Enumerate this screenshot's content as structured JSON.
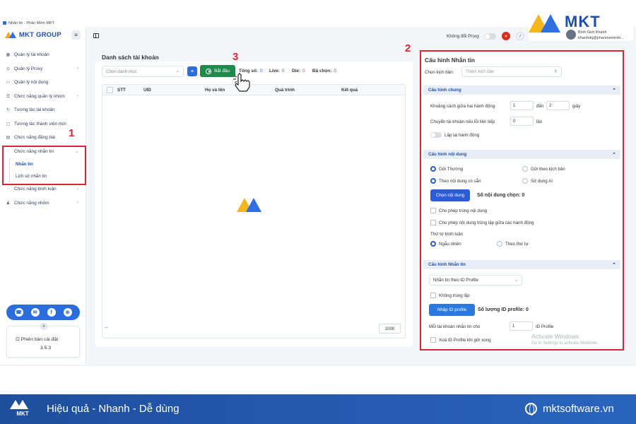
{
  "window": {
    "title": "Nhắn tin - Phần Mềm MKT"
  },
  "brand": {
    "name": "MKT GROUP",
    "top_logo": "MKT",
    "account_name": "Bình Giới Khánh",
    "account_email": "khanhdq@phanmemmkt..."
  },
  "sidebar": {
    "items": [
      {
        "label": "Quản lý tài khoản",
        "icon": "grid-icon",
        "chevron": ""
      },
      {
        "label": "Quản lý Proxy",
        "icon": "globe-icon",
        "chevron": "›"
      },
      {
        "label": "Quản lý nội dung",
        "icon": "message-icon",
        "chevron": ""
      },
      {
        "label": "Chức năng quản lý nhóm",
        "icon": "users-icon",
        "chevron": "›"
      },
      {
        "label": "Tương tác tài khoản",
        "icon": "interact-icon",
        "chevron": ""
      },
      {
        "label": "Tương tác thành viên mới",
        "icon": "newmember-icon",
        "chevron": ""
      },
      {
        "label": "Chức năng đăng bài",
        "icon": "post-icon",
        "chevron": ""
      },
      {
        "label": "Chức năng nhắn tin",
        "icon": "chat-icon",
        "chevron": "⌄"
      }
    ],
    "sub_items": [
      {
        "label": "Nhắn tin"
      },
      {
        "label": "Lịch sử nhắn tin"
      }
    ],
    "items_after": [
      {
        "label": "Chức năng bình luận",
        "icon": "comment-icon",
        "chevron": "›"
      },
      {
        "label": "Chức năng nhóm",
        "icon": "group-icon",
        "chevron": "›"
      }
    ],
    "version_label": "Phiên bản cài đặt",
    "version_number": "3.5.3"
  },
  "topbar": {
    "proxy_label": "Không đổi Proxy"
  },
  "accounts": {
    "title": "Danh sách tài khoản",
    "filter_placeholder": "Chọn danh mục",
    "start_label": "Bắt đầu",
    "stats": [
      {
        "label": "Tổng số:",
        "value": "0"
      },
      {
        "label": "Live:",
        "value": "0"
      },
      {
        "label": "Die:",
        "value": "0"
      },
      {
        "label": "Đã chọn:",
        "value": "0"
      }
    ],
    "columns": [
      "STT",
      "UID",
      "Họ và tên",
      "Quá trình",
      "Kết quả"
    ],
    "footer_dash": "--",
    "page_size": "1000"
  },
  "config": {
    "title": "Cấu hình Nhắn tin",
    "scenario_label": "Chọn kịch bản:",
    "scenario_placeholder": "Thêm kịch bản",
    "general": {
      "header": "Cấu hình chung",
      "interval_label": "Khoảng cách giữa hai hành động",
      "interval_from": "1",
      "to_label": "đến",
      "interval_to": "2",
      "seconds_label": "giây",
      "switch_label": "Chuyển tài khoản nếu lỗi liên tiếp",
      "switch_value": "0",
      "times_label": "lần",
      "repeat_label": "Lặp lại hành động"
    },
    "content": {
      "header": "Cấu hình nội dung",
      "send_normal": "Gửi Thường",
      "send_script": "Gửi theo kịch bản",
      "by_content": "Theo nội dung có sẵn",
      "use_ai": "Sử dụng AI",
      "choose_btn": "Chọn nội dung",
      "chosen_count_label": "Số nội dung chọn: 0",
      "allow_dup": "Cho phép trùng nội dung",
      "allow_dup_between": "Cho phép nội dung trùng lặp giữa các hành động",
      "order_label": "Thứ tự bình luận",
      "random": "Ngẫu nhiên",
      "sequential": "Theo thứ tự"
    },
    "message": {
      "header": "Cấu hình Nhắn tin",
      "mode": "Nhắn tin theo ID Profile",
      "no_dup": "Không trùng lặp",
      "import_btn": "Nhập ID profile",
      "profile_count_label": "Số lượng ID profile: 0",
      "per_account_label": "Mỗi tài khoản nhắn tin cho",
      "per_account_value": "1",
      "per_account_unit": "ID Profile",
      "delete_after": "Xoá ID Profile khi gửi xong"
    },
    "watermark_title": "Activate Windows",
    "watermark_sub": "Go to Settings to activate Windows."
  },
  "annotations": {
    "one": "1",
    "two": "2",
    "three": "3"
  },
  "footer": {
    "logo_text": "MKT",
    "tagline": "Hiệu quả - Nhanh - Dễ dùng",
    "website": "mktsoftware.vn"
  },
  "colors": {
    "accent": "#2b5bd6",
    "start": "#1f8a4c",
    "annotation": "#d9262f",
    "footer": "#2a64bd"
  }
}
